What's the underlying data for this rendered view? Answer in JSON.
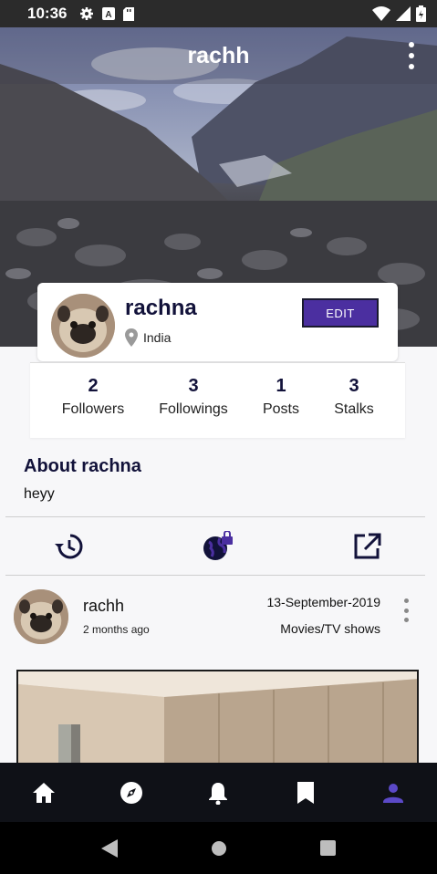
{
  "status_bar": {
    "time": "10:36"
  },
  "cover": {
    "title": "rachh"
  },
  "profile": {
    "name": "rachna",
    "location": "India",
    "edit_label": "EDIT"
  },
  "stats": [
    {
      "value": "2",
      "label": "Followers"
    },
    {
      "value": "3",
      "label": "Followings"
    },
    {
      "value": "1",
      "label": "Posts"
    },
    {
      "value": "3",
      "label": "Stalks"
    }
  ],
  "about": {
    "title": "About rachna",
    "text": "heyy"
  },
  "post": {
    "user": "rachh",
    "time_ago": "2 months ago",
    "date": "13-September-2019",
    "category": "Movies/TV shows"
  },
  "colors": {
    "accent": "#4b2fa0",
    "nav_active": "#5b49c7",
    "nav_bg": "#0f1117"
  },
  "icons": {
    "actions": [
      "history-icon",
      "private-globe-icon",
      "open-external-icon"
    ],
    "nav": [
      "home-icon",
      "explore-compass-icon",
      "notifications-bell-icon",
      "bookmark-icon",
      "profile-icon"
    ]
  }
}
